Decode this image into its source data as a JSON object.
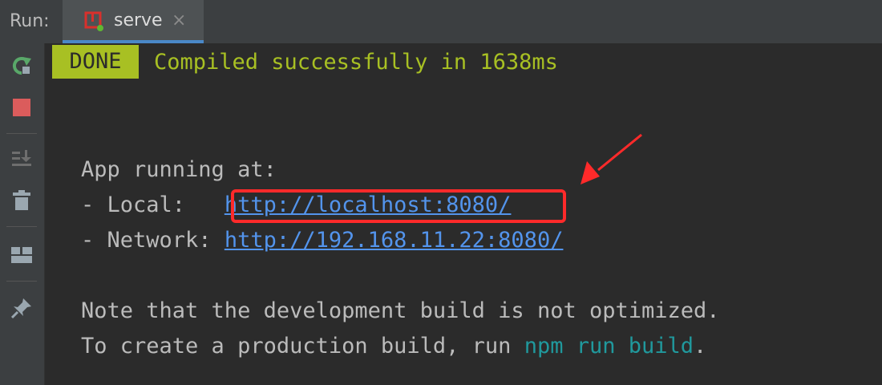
{
  "header": {
    "run_label": "Run:",
    "tab": {
      "label": "serve",
      "close": "×"
    }
  },
  "toolbar": {
    "tools": [
      {
        "name": "rerun-icon"
      },
      {
        "name": "stop-icon"
      },
      {
        "name": "scroll-to-end-icon"
      },
      {
        "name": "clear-all-icon"
      },
      {
        "name": "layout-icon"
      },
      {
        "name": "pin-icon"
      }
    ]
  },
  "console": {
    "badge": "DONE",
    "compiled_message": "Compiled successfully in 1638ms",
    "app_running": "App running at:",
    "local_prefix": "- Local:   ",
    "local_url": "http://localhost:8080/",
    "network_prefix": "- Network: ",
    "network_url": "http://192.168.11.22:8080/",
    "note_line": "Note that the development build is not optimized.",
    "create_prefix": "To create a production build, run ",
    "npm_command": "npm run build",
    "create_suffix": "."
  },
  "colors": {
    "done_badge": "#a8c023",
    "link": "#5394ec",
    "command": "#20999d",
    "annotation": "#ff2a2a",
    "tab_underline": "#4a88c7"
  }
}
